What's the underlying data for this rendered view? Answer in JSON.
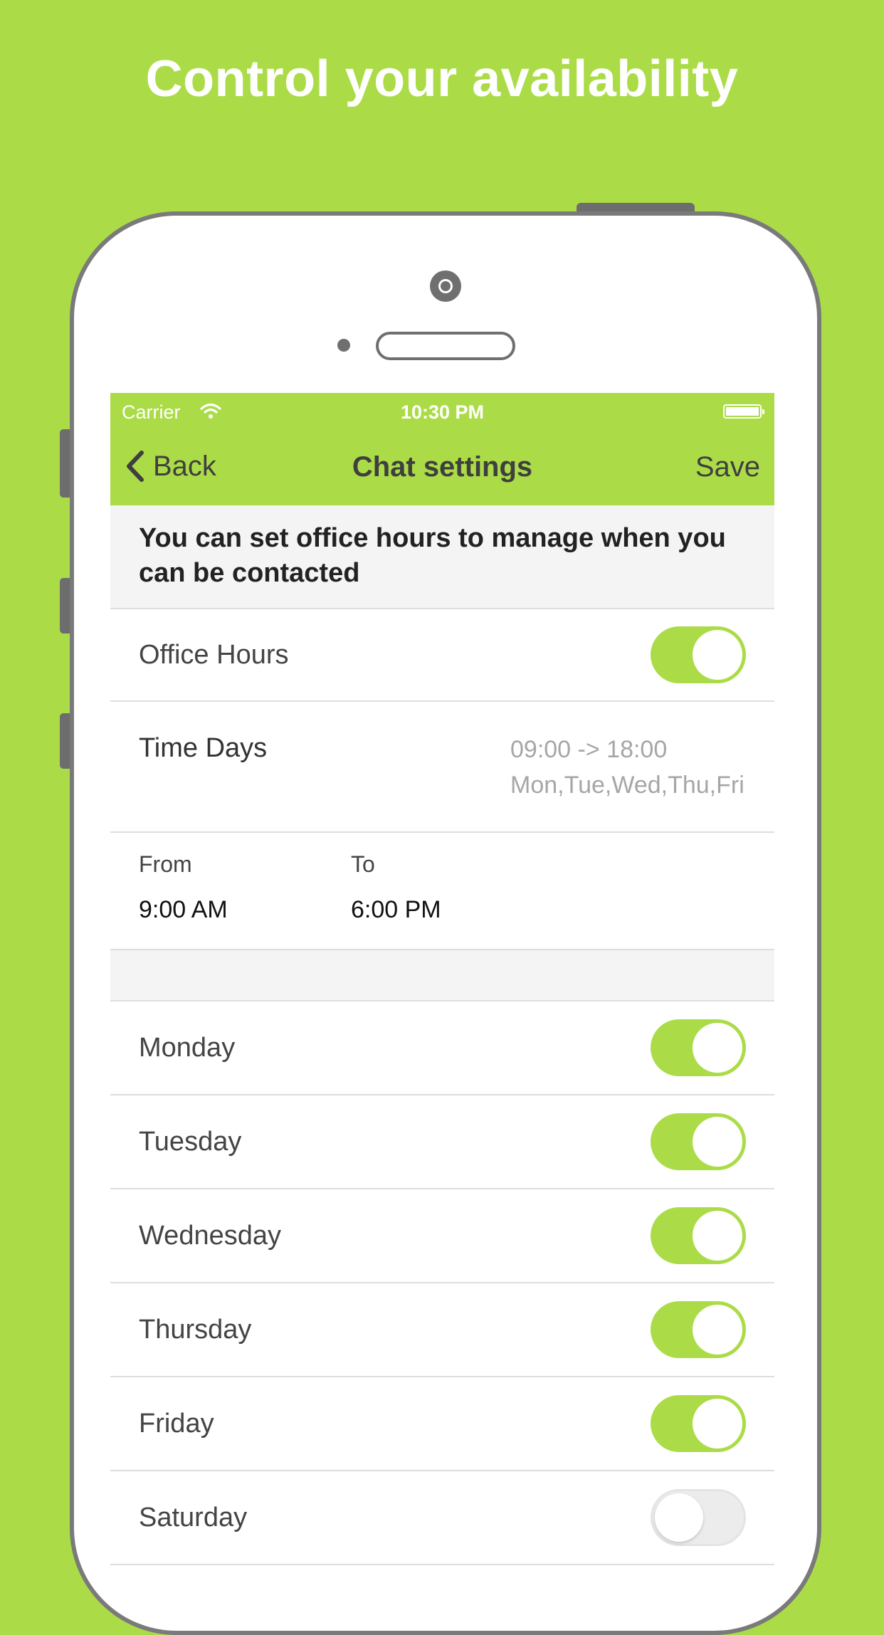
{
  "headline": "Control your availability",
  "status_bar": {
    "carrier": "Carrier",
    "time": "10:30 PM",
    "wifi_icon": "wifi-icon",
    "battery_icon": "battery-icon"
  },
  "nav": {
    "back_label": "Back",
    "title": "Chat settings",
    "save_label": "Save"
  },
  "info_text": "You can set office hours to manage when you can be contacted",
  "office_hours": {
    "label": "Office Hours",
    "enabled": true
  },
  "time_days": {
    "label": "Time Days",
    "range": "09:00 -> 18:00",
    "days": "Mon,Tue,Wed,Thu,Fri"
  },
  "from": {
    "caption": "From",
    "value": "9:00 AM"
  },
  "to": {
    "caption": "To",
    "value": "6:00 PM"
  },
  "days": [
    {
      "label": "Monday",
      "enabled": true
    },
    {
      "label": "Tuesday",
      "enabled": true
    },
    {
      "label": "Wednesday",
      "enabled": true
    },
    {
      "label": "Thursday",
      "enabled": true
    },
    {
      "label": "Friday",
      "enabled": true
    },
    {
      "label": "Saturday",
      "enabled": false
    }
  ],
  "colors": {
    "accent": "#ABDC48",
    "background": "#ABDC48",
    "phone_frame": "#7a7a7a"
  }
}
